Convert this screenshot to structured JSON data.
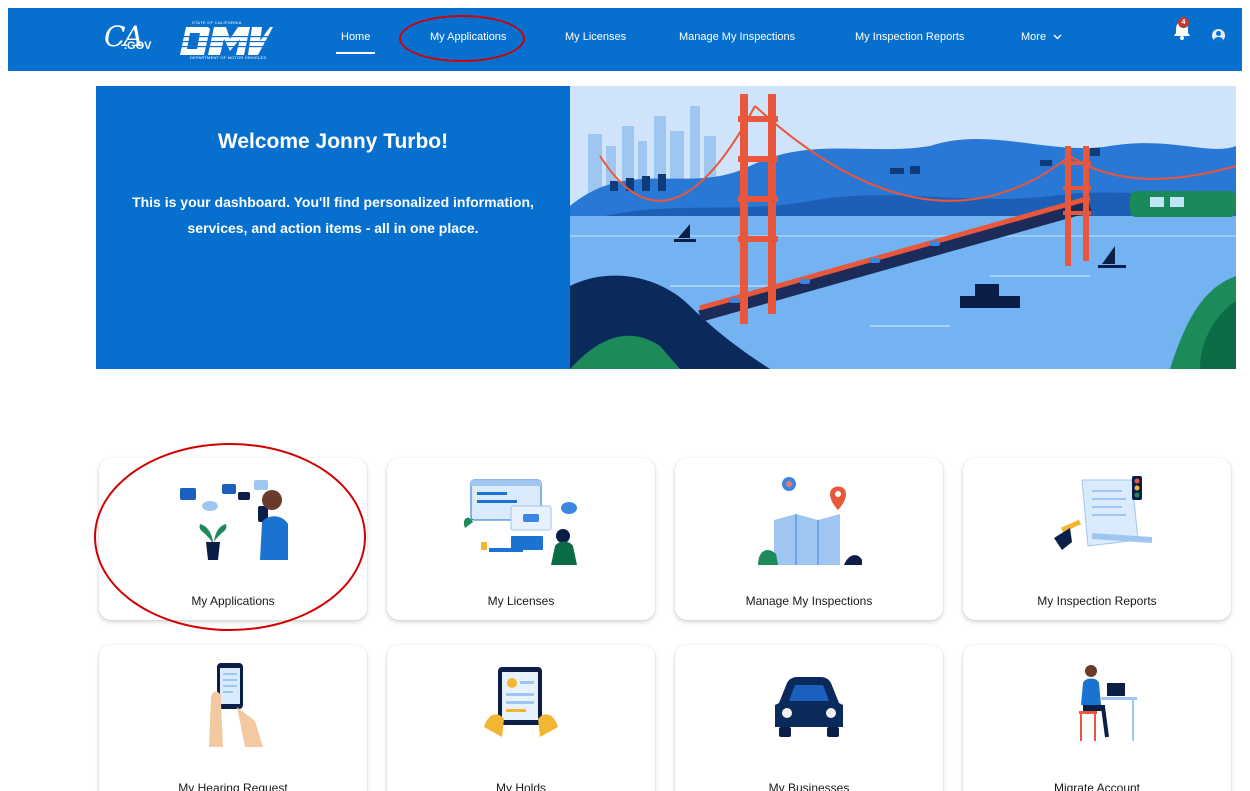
{
  "brand": {
    "ca_logo_text": "CA",
    "ca_gov_text": ".GOV",
    "dmv_logo_text": "DMV",
    "dmv_state_text": "STATE OF CALIFORNIA",
    "dmv_department_text": "DEPARTMENT OF MOTOR VEHICLES",
    "primary_color": "#0770cf"
  },
  "nav": {
    "items": [
      {
        "label": "Home",
        "active": true
      },
      {
        "label": "My Applications",
        "active": false,
        "annotated": true
      },
      {
        "label": "My Licenses",
        "active": false
      },
      {
        "label": "Manage My Inspections",
        "active": false
      },
      {
        "label": "My Inspection Reports",
        "active": false
      },
      {
        "label": "More",
        "active": false,
        "icon": "chevron-down-icon"
      }
    ],
    "notification_count": "4",
    "notification_icon": "bell-icon",
    "user_icon": "user-avatar-icon"
  },
  "hero": {
    "title": "Welcome Jonny Turbo!",
    "subtitle": "This is your dashboard. You'll find personalized information, services, and action items - all in one place.",
    "illustration": "golden-gate-bridge-illustration"
  },
  "tiles": [
    {
      "label": "My Applications",
      "icon": "applications-illustration",
      "annotated": true
    },
    {
      "label": "My Licenses",
      "icon": "licenses-illustration"
    },
    {
      "label": "Manage My Inspections",
      "icon": "inspections-map-illustration"
    },
    {
      "label": "My Inspection Reports",
      "icon": "inspection-reports-illustration"
    },
    {
      "label": "My Hearing Request",
      "icon": "hearing-request-phone-illustration"
    },
    {
      "label": "My Holds",
      "icon": "holds-tablet-illustration"
    },
    {
      "label": "My Businesses",
      "icon": "car-illustration"
    },
    {
      "label": "Migrate Account",
      "icon": "migrate-account-illustration"
    }
  ],
  "annotation_color": "#d10000"
}
